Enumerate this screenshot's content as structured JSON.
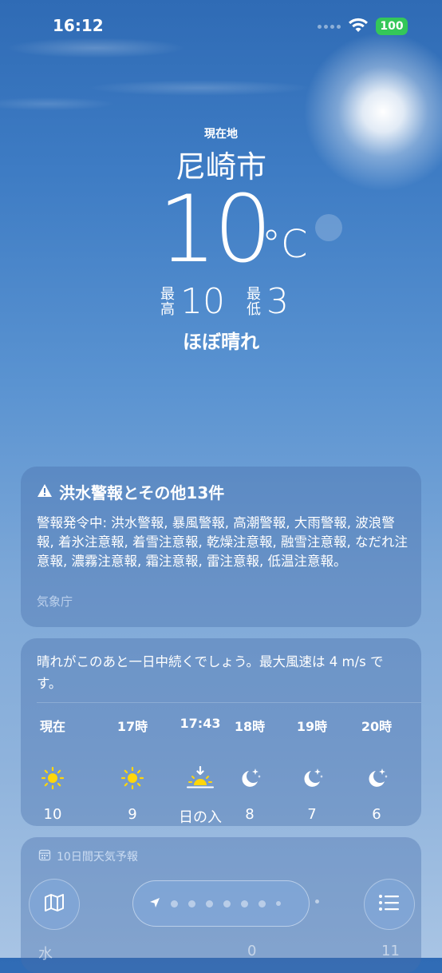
{
  "status_bar": {
    "time": "16:12",
    "battery": "100"
  },
  "header": {
    "location_label": "現在地",
    "city": "尼崎市",
    "temperature": "10",
    "unit": "°C",
    "high_label": "最高",
    "high": "10",
    "low_label": "最低",
    "low": "3",
    "condition": "ほぼ晴れ"
  },
  "alert": {
    "title": "洪水警報とその他13件",
    "body": "警報発令中: 洪水警報, 暴風警報, 高潮警報, 大雨警報, 波浪警報, 着氷注意報, 着雪注意報, 乾燥注意報, 融雪注意報, なだれ注意報, 濃霧注意報, 霜注意報, 雷注意報, 低温注意報。",
    "source": "気象庁"
  },
  "hourly": {
    "summary": "晴れがこのあと一日中続くでしょう。最大風速は 4 m/s です。",
    "items": [
      {
        "time": "現在",
        "icon": "sun-icon",
        "value": "10"
      },
      {
        "time": "17時",
        "icon": "sun-icon",
        "value": "9"
      },
      {
        "time": "17:43",
        "icon": "sunset-icon",
        "value": "日の入"
      },
      {
        "time": "18時",
        "icon": "moon-stars-icon",
        "value": "8"
      },
      {
        "time": "19時",
        "icon": "moon-stars-icon",
        "value": "7"
      },
      {
        "time": "20時",
        "icon": "moon-stars-icon",
        "value": "6"
      }
    ]
  },
  "forecast": {
    "title": "10日間天気予報",
    "peek_day": "水",
    "peek_value": "0",
    "peek_value2": "11"
  },
  "colors": {
    "sun": "#ffd60a",
    "battery": "#34c759"
  }
}
